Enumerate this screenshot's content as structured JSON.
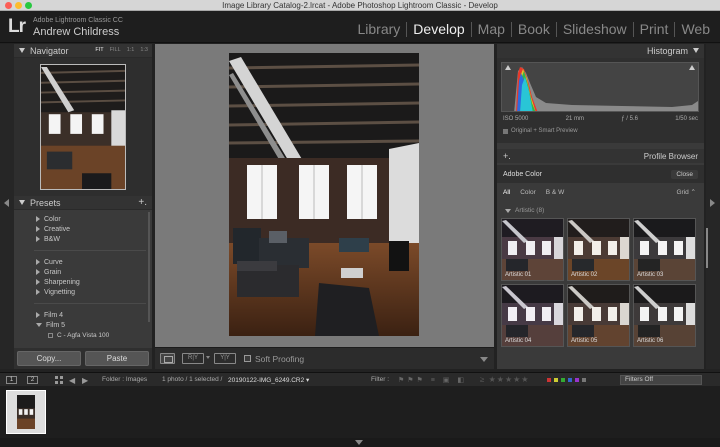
{
  "window": {
    "title": "Image Library Catalog-2.lrcat - Adobe Photoshop Lightroom Classic - Develop"
  },
  "identity": {
    "logo": "Lr",
    "product": "Adobe Lightroom Classic CC",
    "user": "Andrew Childress"
  },
  "modules": [
    {
      "label": "Library",
      "active": false
    },
    {
      "label": "Develop",
      "active": true
    },
    {
      "label": "Map",
      "active": false
    },
    {
      "label": "Book",
      "active": false
    },
    {
      "label": "Slideshow",
      "active": false
    },
    {
      "label": "Print",
      "active": false
    },
    {
      "label": "Web",
      "active": false
    }
  ],
  "navigator": {
    "title": "Navigator",
    "zoom": [
      "FIT",
      "FILL",
      "1:1",
      "1:3"
    ]
  },
  "presets": {
    "title": "Presets",
    "groups_a": [
      "Color",
      "Creative",
      "B&W"
    ],
    "groups_b": [
      "Curve",
      "Grain",
      "Sharpening",
      "Vignetting"
    ],
    "groups_c": [
      "Film 4",
      "Film 5"
    ],
    "sub_item": "C - Agfa Vista 100"
  },
  "buttons": {
    "copy": "Copy...",
    "paste": "Paste"
  },
  "toolbar": {
    "ry": "R|Y",
    "yy": "Y|Y",
    "soft_proofing": "Soft Proofing"
  },
  "histogram": {
    "title": "Histogram",
    "iso": "ISO 5000",
    "focal": "21 mm",
    "aperture": "ƒ / 5.6",
    "shutter": "1/50 sec",
    "preview": "Original + Smart Preview"
  },
  "profile_browser": {
    "title": "Profile Browser",
    "plus": "+.",
    "profile": "Adobe Color",
    "close": "Close",
    "filters": [
      "All",
      "Color",
      "B & W"
    ],
    "view": "Grid",
    "group": "Artistic (8)",
    "thumbs": [
      "Artistic 01",
      "Artistic 02",
      "Artistic 03",
      "Artistic 04",
      "Artistic 05",
      "Artistic 06"
    ]
  },
  "filmstrip": {
    "page1": "1",
    "page2": "2",
    "folder": "Folder : Images",
    "selection": "1 photo / 1 selected /",
    "filename": "20190122-IMG_6249.CR2",
    "filter_label": "Filter :",
    "filters_off": "Filters Off"
  },
  "colors": {
    "accent": "#eeeeee",
    "panel": "#3a3a3a",
    "canvas": "#7a7a7a"
  }
}
